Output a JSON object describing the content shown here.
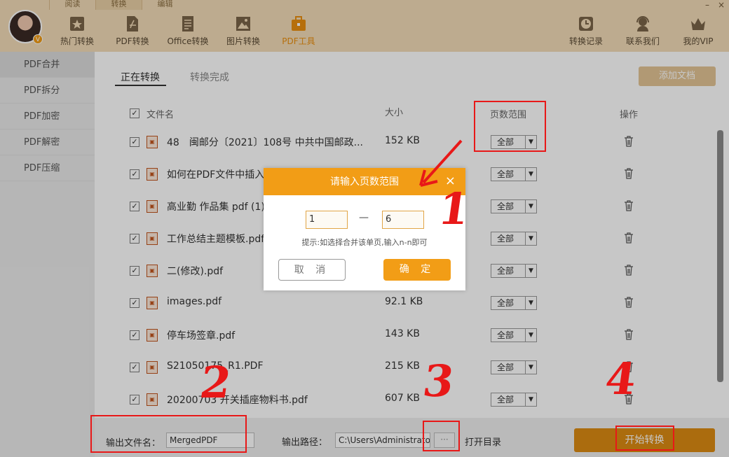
{
  "menu_tabs": [
    "阅读",
    "转换",
    "编辑"
  ],
  "window_controls": [
    "–",
    "×"
  ],
  "vip_badge": "V",
  "nav": [
    {
      "label": "热门转换",
      "icon": "star-icon"
    },
    {
      "label": "PDF转换",
      "icon": "pdf-icon"
    },
    {
      "label": "Office转换",
      "icon": "document-icon"
    },
    {
      "label": "图片转换",
      "icon": "image-icon"
    },
    {
      "label": "PDF工具",
      "icon": "toolbox-icon",
      "active": true
    }
  ],
  "nav_right": [
    {
      "label": "转换记录",
      "icon": "clock-icon"
    },
    {
      "label": "联系我们",
      "icon": "headset-icon"
    },
    {
      "label": "我的VIP",
      "icon": "crown-icon"
    }
  ],
  "sidebar": [
    "PDF合并",
    "PDF拆分",
    "PDF加密",
    "PDF解密",
    "PDF压缩"
  ],
  "tabs": [
    "正在转换",
    "转换完成"
  ],
  "add_button": "添加文档",
  "table": {
    "headers": [
      "文件名",
      "大小",
      "页数范围",
      "操作"
    ],
    "check_mark": "✓",
    "rows": [
      {
        "name": "48　闽邮分〔2021〕108号 中共中国邮政...",
        "size": "152 KB",
        "range": "全部"
      },
      {
        "name": "如何在PDF文件中插入",
        "size": "",
        "range": "全部"
      },
      {
        "name": "高业勤 作品集 pdf (1)",
        "size": "",
        "range": "全部"
      },
      {
        "name": "工作总结主题模板.pdf",
        "size": "",
        "range": "全部"
      },
      {
        "name": "二(修改).pdf",
        "size": "",
        "range": "全部"
      },
      {
        "name": "images.pdf",
        "size": "92.1 KB",
        "range": "全部"
      },
      {
        "name": "停车场签章.pdf",
        "size": "143 KB",
        "range": "全部"
      },
      {
        "name": "S21050175_R1.PDF",
        "size": "215 KB",
        "range": "全部"
      },
      {
        "name": "20200703 开关插座物料书.pdf",
        "size": "607 KB",
        "range": "全部"
      }
    ]
  },
  "bottom": {
    "output_name_label": "输出文件名：",
    "output_name_value": "MergedPDF",
    "output_path_label": "输出路径：",
    "output_path_value": "C:\\Users\\Administrator",
    "browse_label": "···",
    "open_dir": "打开目录",
    "start_button": "开始转换"
  },
  "modal": {
    "title": "请输入页数范围",
    "close": "×",
    "from_value": "1",
    "to_value": "6",
    "dash": "—",
    "hint": "提示:如选择合并该单页,输入n-n即可",
    "cancel": "取 消",
    "ok": "确 定"
  },
  "annotations": [
    "1",
    "2",
    "3",
    "4"
  ],
  "colors": {
    "accent": "#f29d16",
    "annotation": "#e81818",
    "topbar": "#f2dcb8"
  }
}
